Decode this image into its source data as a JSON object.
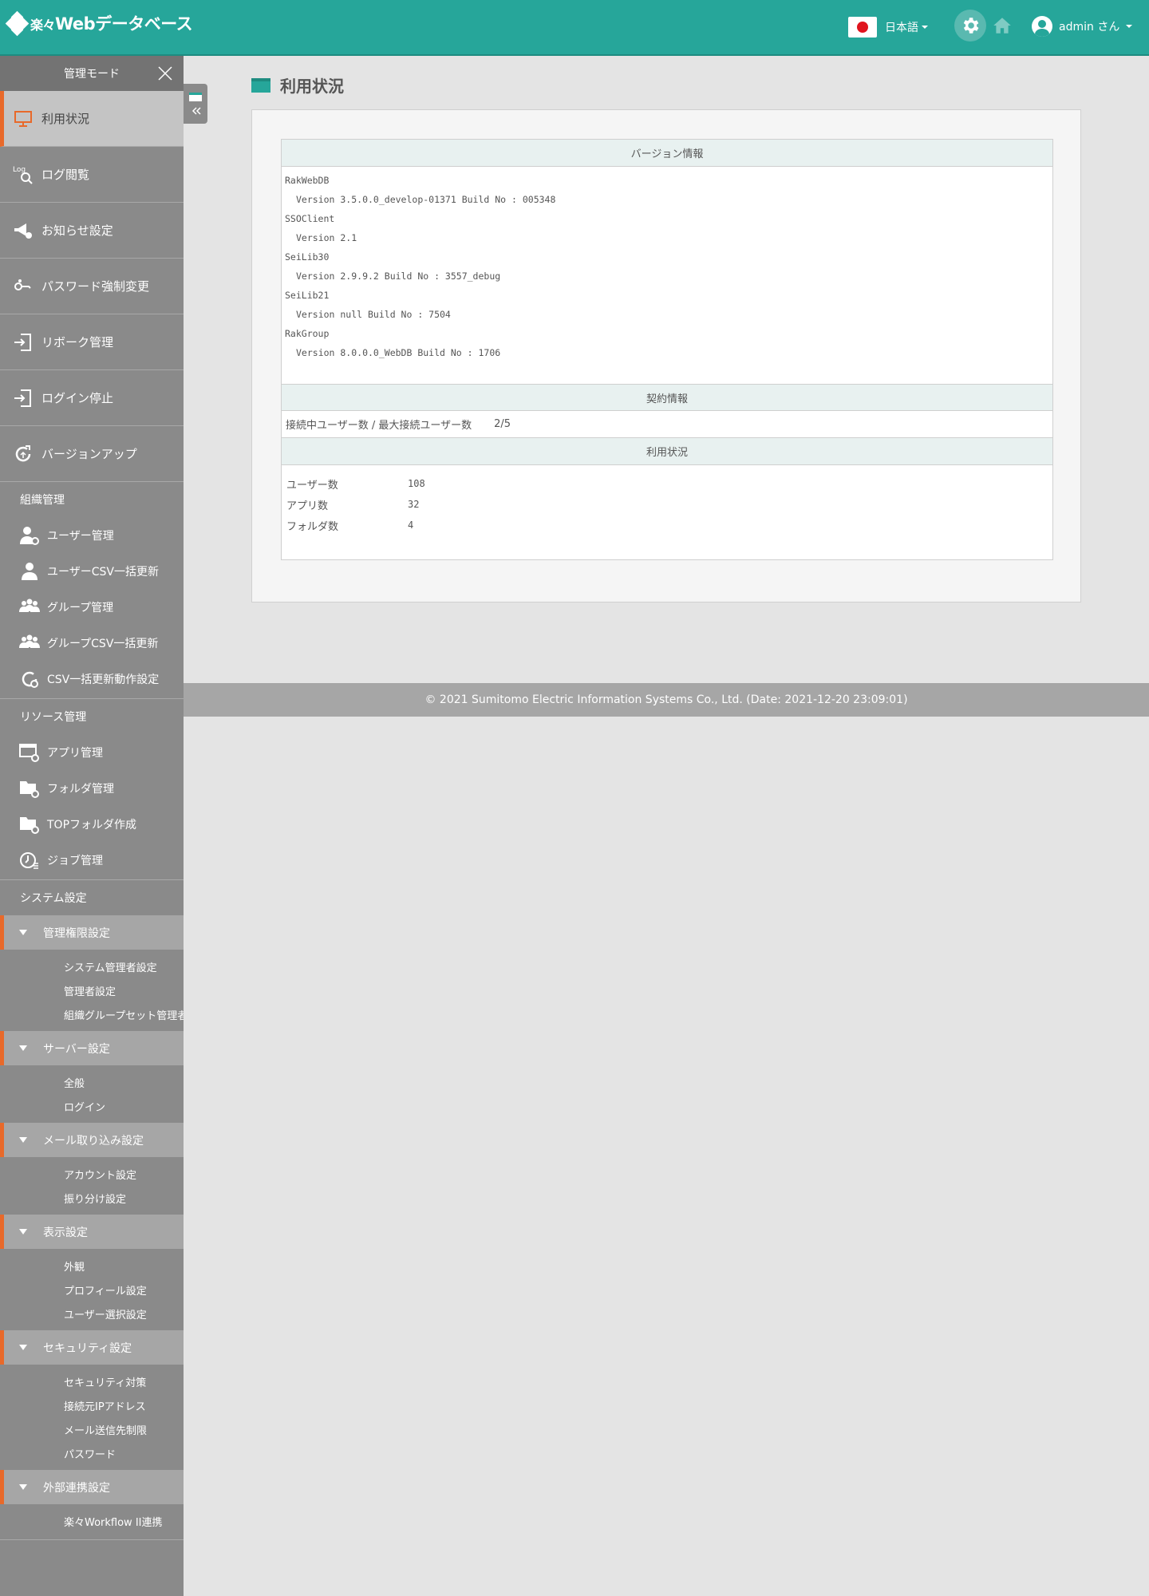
{
  "header": {
    "logo_prefix": "楽々",
    "logo_text": "Webデータベース",
    "language": "日本語",
    "user": "admin さん"
  },
  "sidebar": {
    "title": "管理モード",
    "main_items": [
      {
        "label": "利用状況",
        "icon": "monitor-icon"
      },
      {
        "label": "ログ閲覧",
        "icon": "log-search-icon"
      },
      {
        "label": "お知らせ設定",
        "icon": "megaphone-icon"
      },
      {
        "label": "パスワード強制変更",
        "icon": "key-icon"
      },
      {
        "label": "リボーク管理",
        "icon": "revoke-icon"
      },
      {
        "label": "ログイン停止",
        "icon": "login-stop-icon"
      },
      {
        "label": "バージョンアップ",
        "icon": "version-up-icon"
      }
    ],
    "org_section": "組織管理",
    "org_items": [
      {
        "label": "ユーザー管理",
        "icon": "user-gear-icon"
      },
      {
        "label": "ユーザーCSV一括更新",
        "icon": "user-icon"
      },
      {
        "label": "グループ管理",
        "icon": "group-gear-icon"
      },
      {
        "label": "グループCSV一括更新",
        "icon": "group-icon"
      },
      {
        "label": "CSV一括更新動作設定",
        "icon": "csv-settings-icon"
      }
    ],
    "resource_section": "リソース管理",
    "resource_items": [
      {
        "label": "アプリ管理",
        "icon": "app-gear-icon"
      },
      {
        "label": "フォルダ管理",
        "icon": "folder-gear-icon"
      },
      {
        "label": "TOPフォルダ作成",
        "icon": "folder-add-icon"
      },
      {
        "label": "ジョブ管理",
        "icon": "job-clock-icon"
      }
    ],
    "system_section": "システム設定",
    "groups": [
      {
        "label": "管理権限設定",
        "items": [
          "システム管理者設定",
          "管理者設定",
          "組織グループセット管理者"
        ]
      },
      {
        "label": "サーバー設定",
        "items": [
          "全般",
          "ログイン"
        ]
      },
      {
        "label": "メール取り込み設定",
        "items": [
          "アカウント設定",
          "振り分け設定"
        ]
      },
      {
        "label": "表示設定",
        "items": [
          "外観",
          "プロフィール設定",
          "ユーザー選択設定"
        ]
      },
      {
        "label": "セキュリティ設定",
        "items": [
          "セキュリティ対策",
          "接続元IPアドレス",
          "メール送信先制限",
          "パスワード"
        ]
      },
      {
        "label": "外部連携設定",
        "items": [
          "楽々Workflow II連携"
        ]
      }
    ]
  },
  "main": {
    "title": "利用状況",
    "version_header": "バージョン情報",
    "versions": [
      {
        "text": "RakWebDB",
        "indent": false
      },
      {
        "text": "Version 3.5.0.0_develop-01371  Build No : 005348",
        "indent": true
      },
      {
        "text": "SSOClient",
        "indent": false
      },
      {
        "text": "Version 2.1",
        "indent": true
      },
      {
        "text": "SeiLib30",
        "indent": false
      },
      {
        "text": "Version 2.9.9.2  Build No : 3557_debug",
        "indent": true
      },
      {
        "text": "SeiLib21",
        "indent": false
      },
      {
        "text": "Version null  Build No : 7504",
        "indent": true
      },
      {
        "text": "RakGroup",
        "indent": false
      },
      {
        "text": "Version 8.0.0.0_WebDB  Build No : 1706",
        "indent": true
      }
    ],
    "contract_header": "契約情報",
    "contract_label": "接続中ユーザー数 / 最大接続ユーザー数",
    "contract_value": "2/5",
    "usage_header": "利用状況",
    "usage": [
      {
        "label": "ユーザー数",
        "value": "108"
      },
      {
        "label": "アプリ数",
        "value": "32"
      },
      {
        "label": "フォルダ数",
        "value": "4"
      }
    ]
  },
  "footer": {
    "text": "© 2021 Sumitomo Electric Information Systems Co., Ltd. (Date: 2021-12-20 23:09:01)"
  },
  "colors": {
    "brand": "#26a69a",
    "accent": "#e8692a",
    "sidebar": "#8a8a8a"
  }
}
